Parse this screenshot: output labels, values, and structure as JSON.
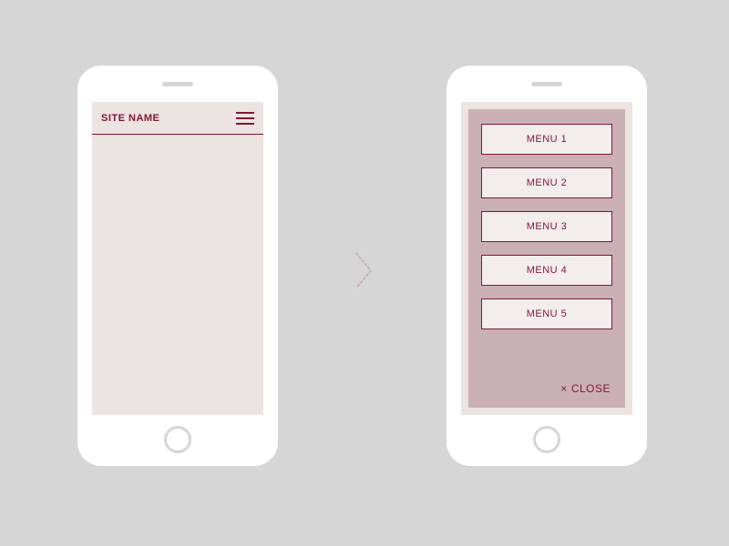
{
  "left_phone": {
    "site_name": "SITE NAME"
  },
  "right_phone": {
    "menu_items": [
      "MENU 1",
      "MENU 2",
      "MENU 3",
      "MENU 4",
      "MENU 5"
    ],
    "close_label": "CLOSE"
  },
  "colors": {
    "accent": "#7f1734",
    "panel": "#cbb0b6",
    "screen_bg": "#ece3e3",
    "page_bg": "#d6d6d6"
  }
}
